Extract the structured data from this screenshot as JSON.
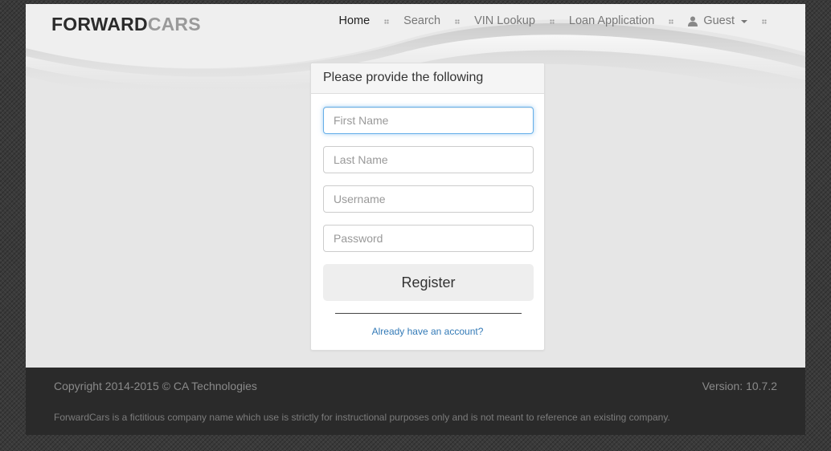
{
  "brand": {
    "part1": "FORWARD",
    "part2": "CARS"
  },
  "nav": {
    "items": [
      {
        "label": "Home",
        "active": true
      },
      {
        "label": "Search"
      },
      {
        "label": "VIN Lookup"
      },
      {
        "label": "Loan Application"
      }
    ],
    "user": {
      "label": "Guest",
      "icon": "user-icon"
    }
  },
  "form": {
    "heading": "Please provide the following",
    "first_name": {
      "placeholder": "First Name",
      "value": ""
    },
    "last_name": {
      "placeholder": "Last Name",
      "value": ""
    },
    "username": {
      "placeholder": "Username",
      "value": ""
    },
    "password": {
      "placeholder": "Password",
      "value": ""
    },
    "register_label": "Register",
    "login_link": "Already have an account?"
  },
  "footer": {
    "copyright": "Copyright 2014-2015 © CA Technologies",
    "version": "Version: 10.7.2",
    "disclaimer": "ForwardCars is a fictitious company name which use is strictly for instructional purposes only and is not meant to reference an existing company."
  },
  "colors": {
    "accent_link": "#337ab7",
    "focus_border": "#66afe9",
    "footer_bg": "#2a2a2a"
  }
}
